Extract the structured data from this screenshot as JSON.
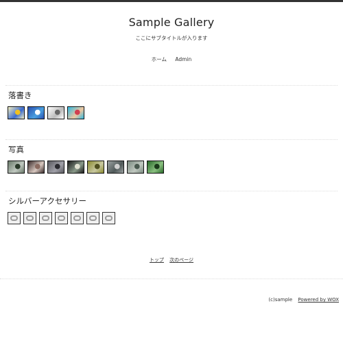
{
  "site": {
    "title": "Sample Gallery",
    "subtitle": "ここにサブタイトルが入ります"
  },
  "nav": {
    "items": [
      {
        "label": "ホーム"
      },
      {
        "label": "Admin"
      }
    ]
  },
  "sections": [
    {
      "title": "落書き",
      "thumbs": [
        {
          "colors": [
            "#f5f0c0",
            "#3a6bd0",
            "#f0c020"
          ]
        },
        {
          "colors": [
            "#2a4fb0",
            "#4aa0e0",
            "#ffffff"
          ]
        },
        {
          "colors": [
            "#ffffff",
            "#bbbbbb",
            "#666666"
          ]
        },
        {
          "colors": [
            "#30b8e0",
            "#f0c8a0",
            "#d04050"
          ]
        }
      ]
    },
    {
      "title": "写真",
      "thumbs": [
        {
          "colors": [
            "#6a7a6a",
            "#c0c8c0",
            "#2a3a2a"
          ]
        },
        {
          "colors": [
            "#3a2a2a",
            "#d8c8c0",
            "#8a6a60"
          ]
        },
        {
          "colors": [
            "#5a5a60",
            "#a0a0a8",
            "#2a2a30"
          ]
        },
        {
          "colors": [
            "#1a1a1a",
            "#8a9a8a",
            "#e0e0d0"
          ]
        },
        {
          "colors": [
            "#8a8a30",
            "#c8c8a0",
            "#505020"
          ]
        },
        {
          "colors": [
            "#9aa0a0",
            "#505a5a",
            "#d0d0d0"
          ]
        },
        {
          "colors": [
            "#7a8a80",
            "#c0c8c0",
            "#4a5a50"
          ]
        },
        {
          "colors": [
            "#2a6a2a",
            "#8ac080",
            "#1a3a1a"
          ]
        }
      ]
    },
    {
      "title": "シルバーアクセサリー",
      "thumbs": [
        {},
        {},
        {},
        {},
        {},
        {},
        {}
      ]
    }
  ],
  "pager": {
    "top": "トップ",
    "next": "次のページ"
  },
  "footer": {
    "copyright": "(c)sample",
    "powered": "Powered by WOX"
  }
}
